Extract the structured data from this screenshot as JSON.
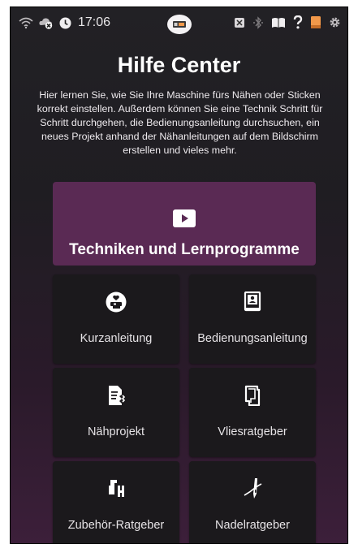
{
  "status_bar": {
    "time": "17:06",
    "left_icons": [
      "wifi-icon",
      "cloud-off-icon",
      "clock-icon"
    ],
    "center_icon": "machine-indicator-icon",
    "right_icons": [
      "embroidery-icon",
      "bluetooth-icon",
      "book-icon",
      "help-icon",
      "color-icon",
      "settings-icon"
    ]
  },
  "page": {
    "title": "Hilfe Center",
    "intro": "Hier lernen Sie, wie Sie Ihre Maschine fürs Nähen oder Sticken korrekt einstellen. Außerdem können Sie eine Technik Schritt für Schritt durchgehen, die Bedienungsanleitung durchsuchen, ein neues Projekt anhand der Nähanleitungen auf dem Bildschirm erstellen und vieles mehr."
  },
  "hero": {
    "label": "Techniken und Lernprogramme",
    "icon": "play-icon"
  },
  "tiles": [
    {
      "label": "Kurzanleitung",
      "icon": "quick-guide-icon"
    },
    {
      "label": "Bedienungsanleitung",
      "icon": "manual-icon"
    },
    {
      "label": "Nähprojekt",
      "icon": "sewing-project-icon"
    },
    {
      "label": "Vliesratgeber",
      "icon": "stabilizer-icon"
    },
    {
      "label": "Zubehör-Ratgeber",
      "icon": "accessory-icon"
    },
    {
      "label": "Nadelratgeber",
      "icon": "needle-icon"
    }
  ],
  "colors": {
    "hero_bg": "#5a2a54",
    "tile_bg": "#1b191c",
    "accent_orange": "#f2994a"
  }
}
